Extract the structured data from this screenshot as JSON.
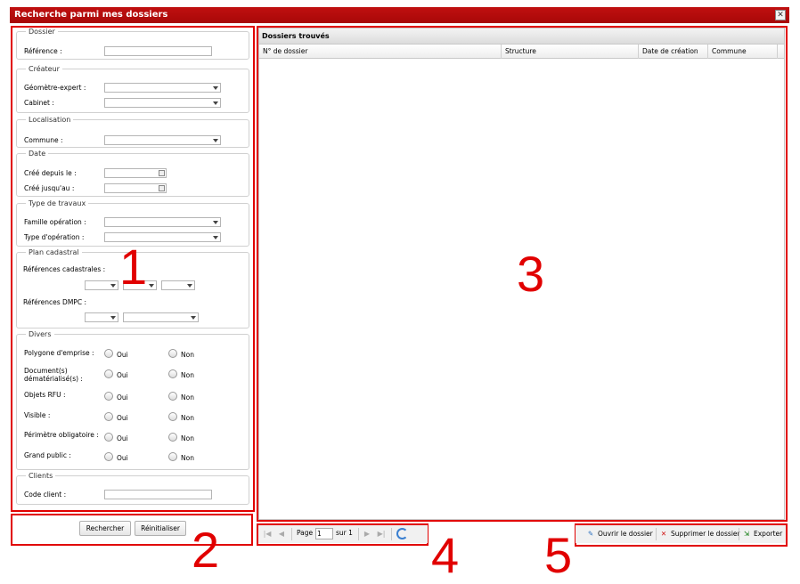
{
  "window": {
    "title": "Recherche parmi mes dossiers",
    "close_label": "✕"
  },
  "form": {
    "dossier": {
      "legend": "Dossier",
      "reference_label": "Référence :"
    },
    "createur": {
      "legend": "Créateur",
      "geometre_label": "Géomètre-expert :",
      "cabinet_label": "Cabinet :"
    },
    "localisation": {
      "legend": "Localisation",
      "commune_label": "Commune :"
    },
    "date": {
      "legend": "Date",
      "depuis_label": "Créé depuis le :",
      "jusquau_label": "Créé jusqu'au :"
    },
    "travaux": {
      "legend": "Type de travaux",
      "famille_label": "Famille opération :",
      "type_label": "Type d'opération :"
    },
    "cadastre": {
      "legend": "Plan cadastral",
      "refs_label": "Références cadastrales :",
      "dmpc_label": "Références DMPC :"
    },
    "divers": {
      "legend": "Divers",
      "oui": "Oui",
      "non": "Non",
      "rows": [
        "Polygone d'emprise :",
        "Document(s) dématérialisé(s) :",
        "Objets RFU :",
        "Visible :",
        "Périmètre obligatoire :",
        "Grand public :"
      ]
    },
    "clients": {
      "legend": "Clients",
      "code_label": "Code client :"
    }
  },
  "buttons": {
    "search": "Rechercher",
    "reset": "Réinitialiser"
  },
  "results": {
    "title": "Dossiers trouvés",
    "columns": [
      "N° de dossier",
      "Structure",
      "Date de création",
      "Commune"
    ]
  },
  "pager": {
    "page_label": "Page",
    "page_value": "1",
    "of_label": "sur 1"
  },
  "actions": {
    "open": "Ouvrir le dossier",
    "delete": "Supprimer le dossier",
    "export": "Exporter"
  },
  "annotations": {
    "n1": "1",
    "n2": "2",
    "n3": "3",
    "n4": "4",
    "n5": "5"
  },
  "colors": {
    "title_bar": "#b80c0c",
    "annotation": "#e10000"
  }
}
